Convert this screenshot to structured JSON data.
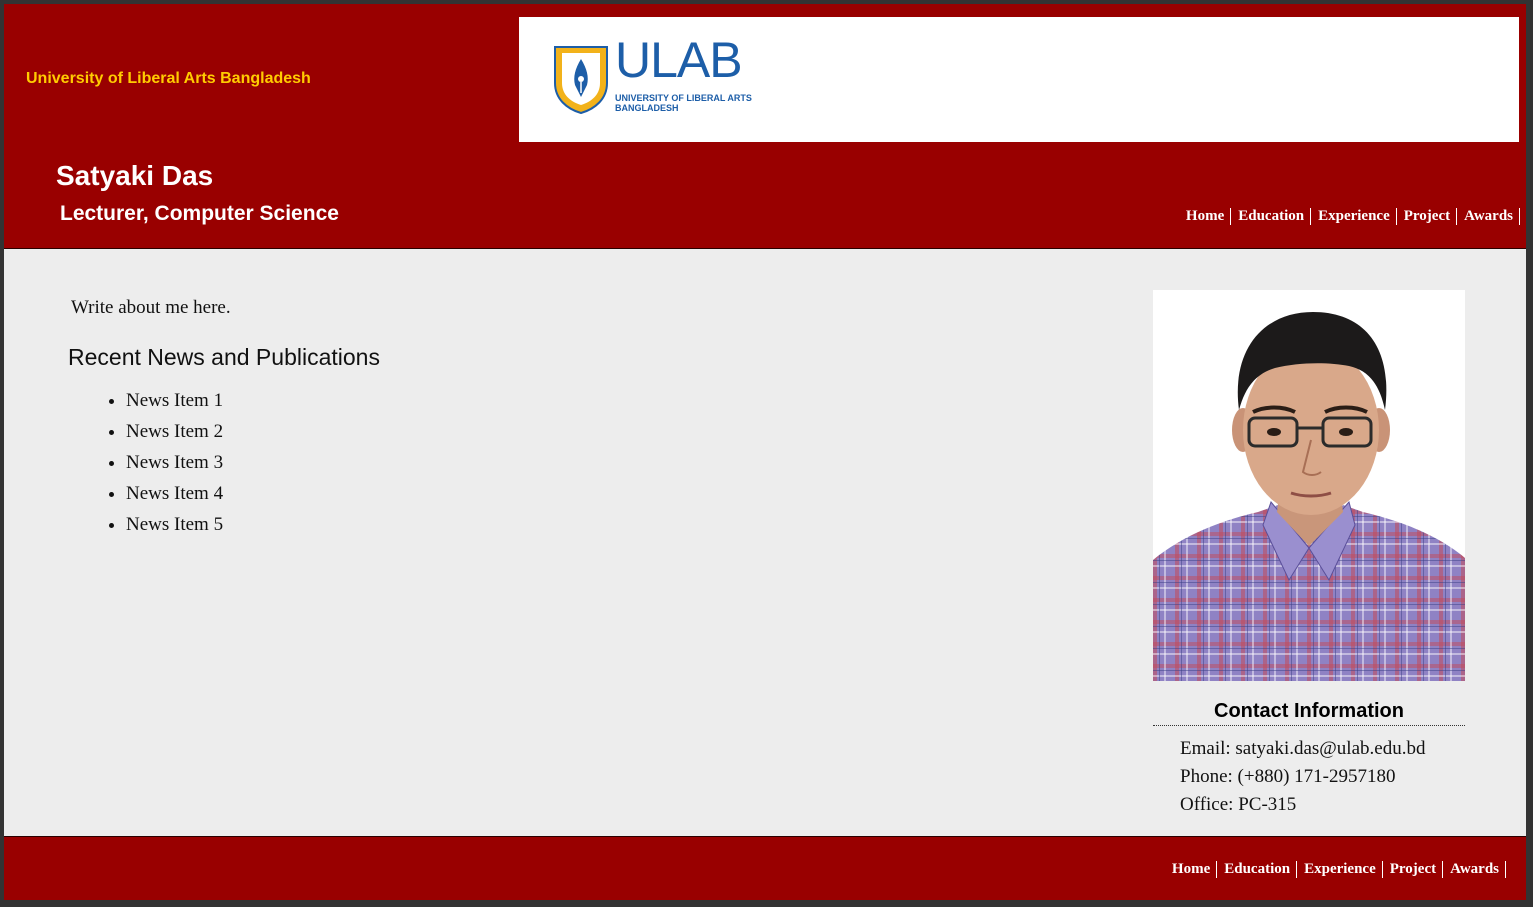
{
  "header": {
    "university_name": "University of Liberal Arts Bangladesh",
    "logo_text": "ULAB",
    "logo_subtitle_line1": "UNIVERSITY OF LIBERAL ARTS",
    "logo_subtitle_line2": "BANGLADESH",
    "person_name": "Satyaki Das",
    "person_title": "Lecturer, Computer Science"
  },
  "nav": {
    "items": [
      "Home",
      "Education",
      "Experience",
      "Project",
      "Awards"
    ]
  },
  "main": {
    "about": "Write about me here.",
    "news_heading": "Recent News and Publications",
    "news_items": [
      "News Item 1",
      "News Item 2",
      "News Item 3",
      "News Item 4",
      "News Item 5"
    ]
  },
  "contact": {
    "heading": "Contact Information",
    "email": "Email: satyaki.das@ulab.edu.bd",
    "phone": "Phone: (+880) 171-2957180",
    "office": "Office: PC-315"
  },
  "colors": {
    "brand_red": "#990000",
    "university_name_yellow": "#ffcc00",
    "logo_blue": "#1d5ea8",
    "page_background": "#ededed"
  }
}
